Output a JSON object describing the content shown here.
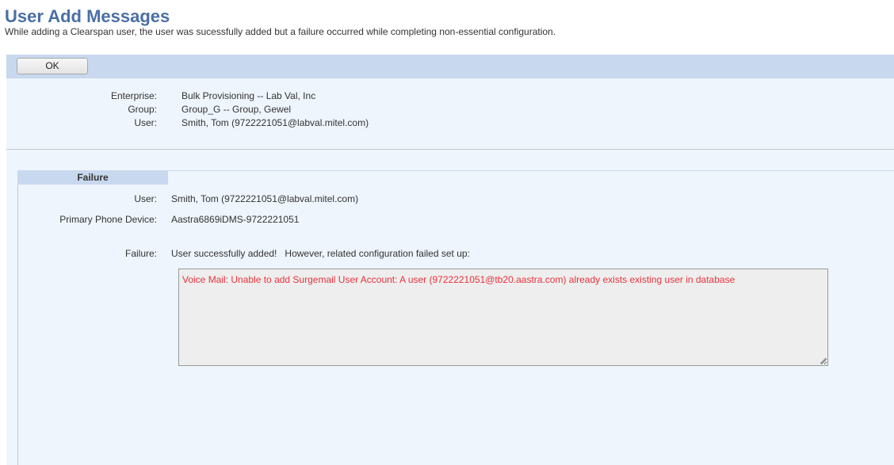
{
  "page": {
    "title": "User Add Messages",
    "subtitle": "While adding a Clearspan user, the user was sucessfully added but a failure occurred while completing non-essential configuration."
  },
  "toolbar": {
    "ok_label": "OK"
  },
  "info": {
    "enterprise_label": "Enterprise:",
    "enterprise_value": "Bulk Provisioning -- Lab Val, Inc",
    "group_label": "Group:",
    "group_value": "Group_G -- Group, Gewel",
    "user_label": "User:",
    "user_value": "Smith, Tom (9722221051@labval.mitel.com)"
  },
  "failure": {
    "section_title": "Failure",
    "user_label": "User:",
    "user_value": "Smith, Tom (9722221051@labval.mitel.com)",
    "device_label": "Primary Phone Device:",
    "device_value": "Aastra6869iDMS-9722221051",
    "failure_label": "Failure:",
    "failure_value": "User successfully added!   However, related configuration failed set up:",
    "message_text": "Voice Mail: Unable to add Surgemail User Account: A user (9722221051@tb20.aastra.com) already exists existing user in database"
  },
  "colors": {
    "title": "#4a6fa5",
    "toolbar_bg": "#c8d8ee",
    "panel_bg": "#eef5fc",
    "error_text": "#e8323c"
  }
}
